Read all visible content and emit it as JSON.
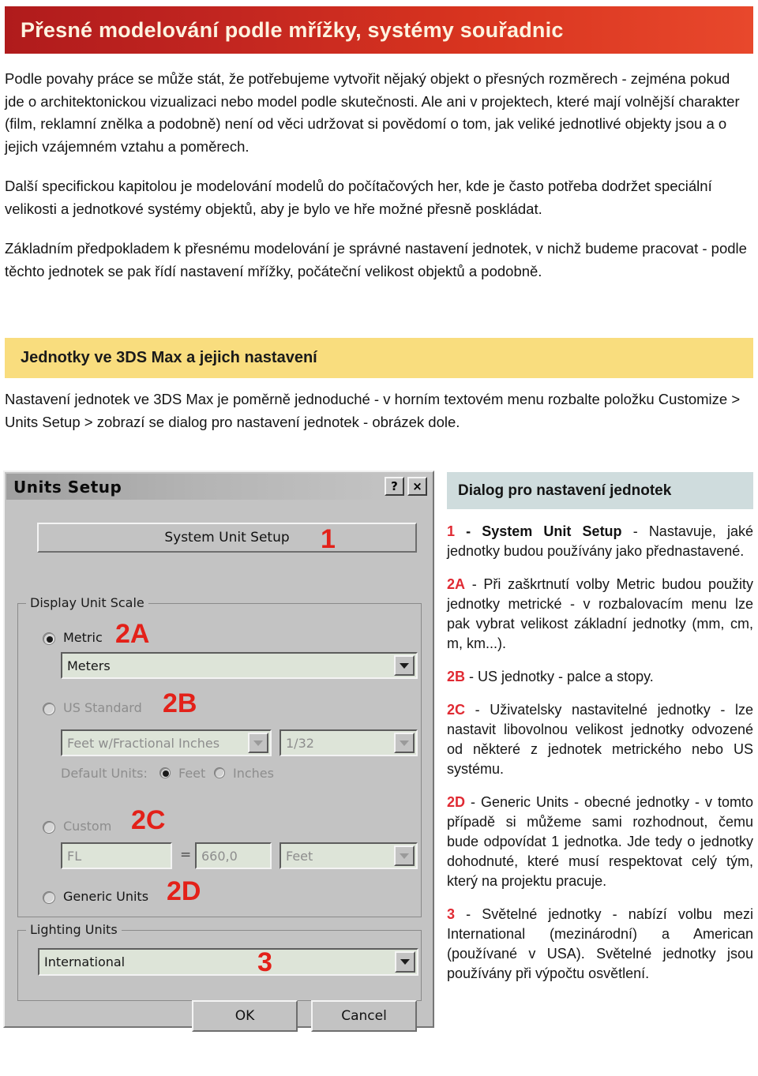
{
  "header": {
    "title": "Přesné modelování podle mřížky, systémy souřadnic",
    "bg_start": "#b01b1c",
    "bg_end": "#e8482c",
    "text_color": "#fdf3e0"
  },
  "intro": {
    "paragraph_1": "Podle povahy práce se může stát, že potřebujeme vytvořit nějaký objekt o přesných rozměrech - zejména pokud jde o architektonickou vizualizaci nebo model podle skutečnosti. Ale ani v projektech, které mají volnější charakter (film, reklamní znělka a podobně) není od věci udržovat si povědomí o tom, jak veliké jednotlivé objekty jsou a o jejich vzájemném vztahu a poměrech.",
    "paragraph_2": "Další specifickou kapitolou je modelování modelů do počítačových her, kde je často potřeba dodržet speciální velikosti a jednotkové systémy objektů, aby je bylo ve hře možné přesně poskládat.",
    "paragraph_3": "Základním předpokladem k přesnému modelování je správné nastavení jednotek, v nichž budeme pracovat - podle těchto jednotek se pak řídí nastavení mřížky, počáteční velikost objektů a podobně."
  },
  "section": {
    "title": "Jednotky ve 3DS Max a jejich nastavení",
    "bg": "#f9dd7e",
    "body": "Nastavení jednotek ve 3DS Max je poměrně jednoduché - v horním textovém menu rozbalte položku Customize > Units Setup > zobrazí se dialog pro nastavení jednotek - obrázek dole."
  },
  "dialog": {
    "title": "Units Setup",
    "help_button": "?",
    "close_button": "×",
    "system_unit_setup_button": "System Unit Setup",
    "display_unit_scale": {
      "group_label": "Display Unit Scale",
      "metric_label": "Metric",
      "metric_selected": true,
      "metric_value": "Meters",
      "us_standard_label": "US Standard",
      "us_standard_selected": false,
      "us_standard_value": "Feet w/Fractional Inches",
      "us_fraction_value": "1/32",
      "default_units_label": "Default Units:",
      "default_feet_label": "Feet",
      "default_feet_selected": true,
      "default_inches_label": "Inches",
      "default_inches_selected": false,
      "custom_label": "Custom",
      "custom_selected": false,
      "custom_name_value": "FL",
      "custom_equals": "=",
      "custom_amount_value": "660,0",
      "custom_unit_value": "Feet",
      "generic_units_label": "Generic Units",
      "generic_units_selected": false
    },
    "lighting_units": {
      "group_label": "Lighting Units",
      "value": "International"
    },
    "ok_button": "OK",
    "cancel_button": "Cancel",
    "callouts": {
      "one": "1",
      "two_a": "2A",
      "two_b": "2B",
      "two_c": "2C",
      "two_d": "2D",
      "three": "3"
    },
    "callout_color": "#e32119"
  },
  "legend": {
    "header": "Dialog pro nastavení jednotek",
    "header_bg": "#cfdcdd",
    "items": [
      {
        "num": "1",
        "bold": " - System Unit Setup",
        "text": " - Nastavuje, jaké jednotky budou používány jako přednastavené."
      },
      {
        "num": "2A",
        "bold": "",
        "text": " - Při zaškrtnutí volby Metric budou použity jednotky metrické - v rozbalovacím menu lze pak vybrat velikost základní jednotky (mm, cm, m, km...)."
      },
      {
        "num": "2B",
        "bold": "",
        "text": " - US jednotky - palce a stopy."
      },
      {
        "num": "2C",
        "bold": "",
        "text": " - Uživatelsky nastavitelné jednotky - lze nastavit libovolnou velikost jednotky odvozené od některé z jednotek metrického nebo US systému."
      },
      {
        "num": "2D",
        "bold": "",
        "text": " - Generic Units - obecné jednotky - v tomto případě si můžeme sami rozhodnout, čemu bude odpovídat 1 jednotka. Jde tedy o jednotky dohodnuté, které musí respektovat celý tým, který na projektu pracuje."
      },
      {
        "num": "3",
        "bold": "",
        "text": " - Světelné jednotky - nabízí volbu mezi International (mezinárodní) a American (používané v USA). Světelné jednotky jsou používány při výpočtu osvětlení."
      }
    ]
  }
}
